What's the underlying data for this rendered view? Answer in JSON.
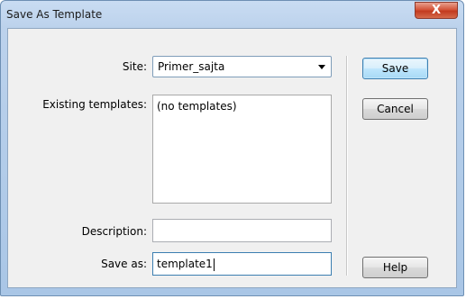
{
  "window": {
    "title": "Save As Template",
    "close_glyph": "X"
  },
  "form": {
    "site_label": "Site:",
    "site_value": "Primer_sajta",
    "existing_label": "Existing templates:",
    "existing_items": [
      "(no templates)"
    ],
    "description_label": "Description:",
    "description_value": "",
    "saveas_label": "Save as:",
    "saveas_value": "template1"
  },
  "buttons": {
    "save": "Save",
    "cancel": "Cancel",
    "help": "Help"
  },
  "colors": {
    "default_button_border": "#3c7fb1",
    "close_button": "#c23b1f"
  }
}
